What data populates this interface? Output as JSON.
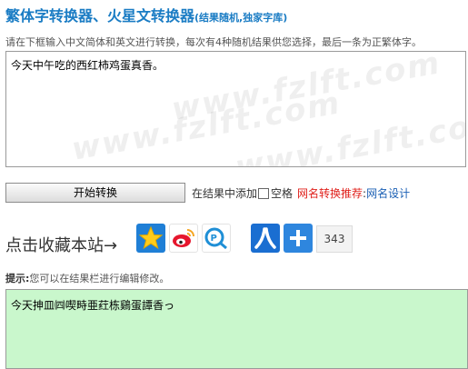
{
  "header": {
    "title": "繁体字转换器、火星文转换器",
    "subtitle": "(结果随机,独家字库)"
  },
  "description": "请在下框输入中文简体和英文进行转换，每次有4种随机结果供您选择，最后一条为正繁体字。",
  "input": {
    "value": "今天中午吃的西红柿鸡蛋真香。",
    "watermark": "www.fzlft.com"
  },
  "controls": {
    "start_button": "开始转换",
    "add_space_prefix": "在结果中添加",
    "add_space_label": "空格",
    "recommend_link": "网名转换推荐",
    "colon": ":",
    "name_design_link": "网名设计"
  },
  "favorite": {
    "label": "点击收藏本站→",
    "share_count": "343",
    "share_icons": [
      "qq-favorite-icon",
      "weibo-icon",
      "qzone-icon",
      "renren-icon",
      "add-more-icon"
    ]
  },
  "tip": {
    "label": "提示:",
    "text": "您可以在结果栏进行编辑修改。"
  },
  "output": {
    "value": "今天抻皿㈣喫畤亜荭栋鷄蛋譚香っ"
  },
  "colors": {
    "title": "#1a7cc4",
    "recommend": "#e0201b",
    "link": "#1a5fb4",
    "output_bg": "#c9f7cc"
  }
}
